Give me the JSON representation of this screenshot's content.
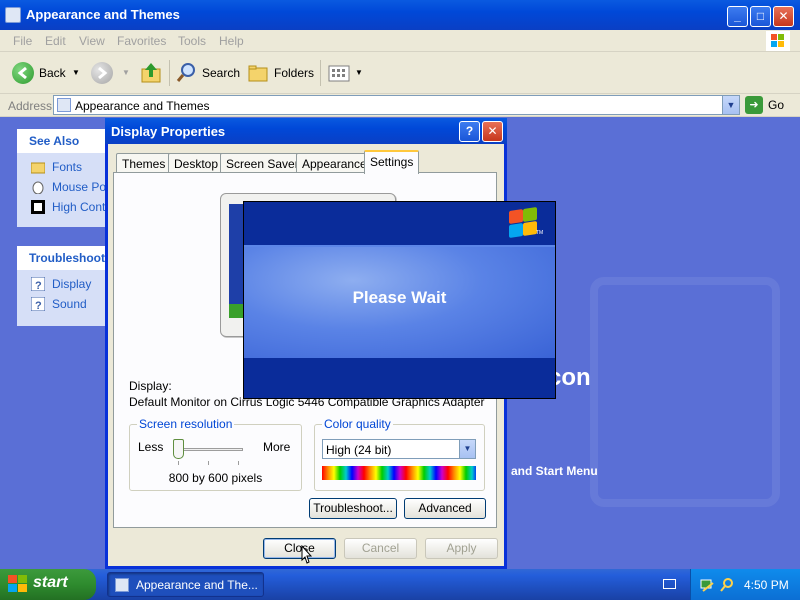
{
  "window": {
    "title": "Appearance and Themes",
    "controls": [
      "minimize",
      "maximize",
      "close"
    ]
  },
  "menubar": {
    "items": [
      "File",
      "Edit",
      "View",
      "Favorites",
      "Tools",
      "Help"
    ]
  },
  "toolbar": {
    "back_label": "Back",
    "search_label": "Search",
    "folders_label": "Folders"
  },
  "address": {
    "label": "Address",
    "value": "Appearance and Themes",
    "go_label": "Go"
  },
  "content": {
    "background_text": "con",
    "background_subtext": "and Start Menu"
  },
  "see_also": {
    "title": "See Also",
    "items": [
      {
        "label": "Fonts",
        "icon": "folder-icon"
      },
      {
        "label": "Mouse Pointers",
        "icon": "mouse-icon"
      },
      {
        "label": "High Contrast",
        "icon": "contrast-icon"
      }
    ]
  },
  "troubleshooters": {
    "title": "Troubleshooters",
    "items": [
      {
        "label": "Display",
        "icon": "help-icon"
      },
      {
        "label": "Sound",
        "icon": "help-icon"
      }
    ]
  },
  "dialog": {
    "title": "Display Properties",
    "tabs": [
      "Themes",
      "Desktop",
      "Screen Saver",
      "Appearance",
      "Settings"
    ],
    "active_tab": "Settings",
    "display_label": "Display:",
    "display_value": "Default Monitor on Cirrus Logic 5446 Compatible Graphics Adapter",
    "screen_resolution": {
      "legend": "Screen resolution",
      "less": "Less",
      "more": "More",
      "value": "800 by 600 pixels"
    },
    "color_quality": {
      "legend": "Color quality",
      "selected": "High (24 bit)"
    },
    "buttons": {
      "troubleshoot": "Troubleshoot...",
      "advanced": "Advanced",
      "close": "Close",
      "cancel": "Cancel",
      "apply": "Apply"
    }
  },
  "splash": {
    "message": "Please Wait",
    "logo_mark": "TM"
  },
  "taskbar": {
    "start_label": "start",
    "task_item": "Appearance and The...",
    "clock": "4:50 PM"
  },
  "colors": {
    "title_bar": "#0a4fd8",
    "taskbar": "#245edb",
    "start_button": "#2e8b2e",
    "content_background": "#5a6fd6",
    "splash_dark": "#0a2c9a",
    "splash_light": "#5a83e6"
  }
}
